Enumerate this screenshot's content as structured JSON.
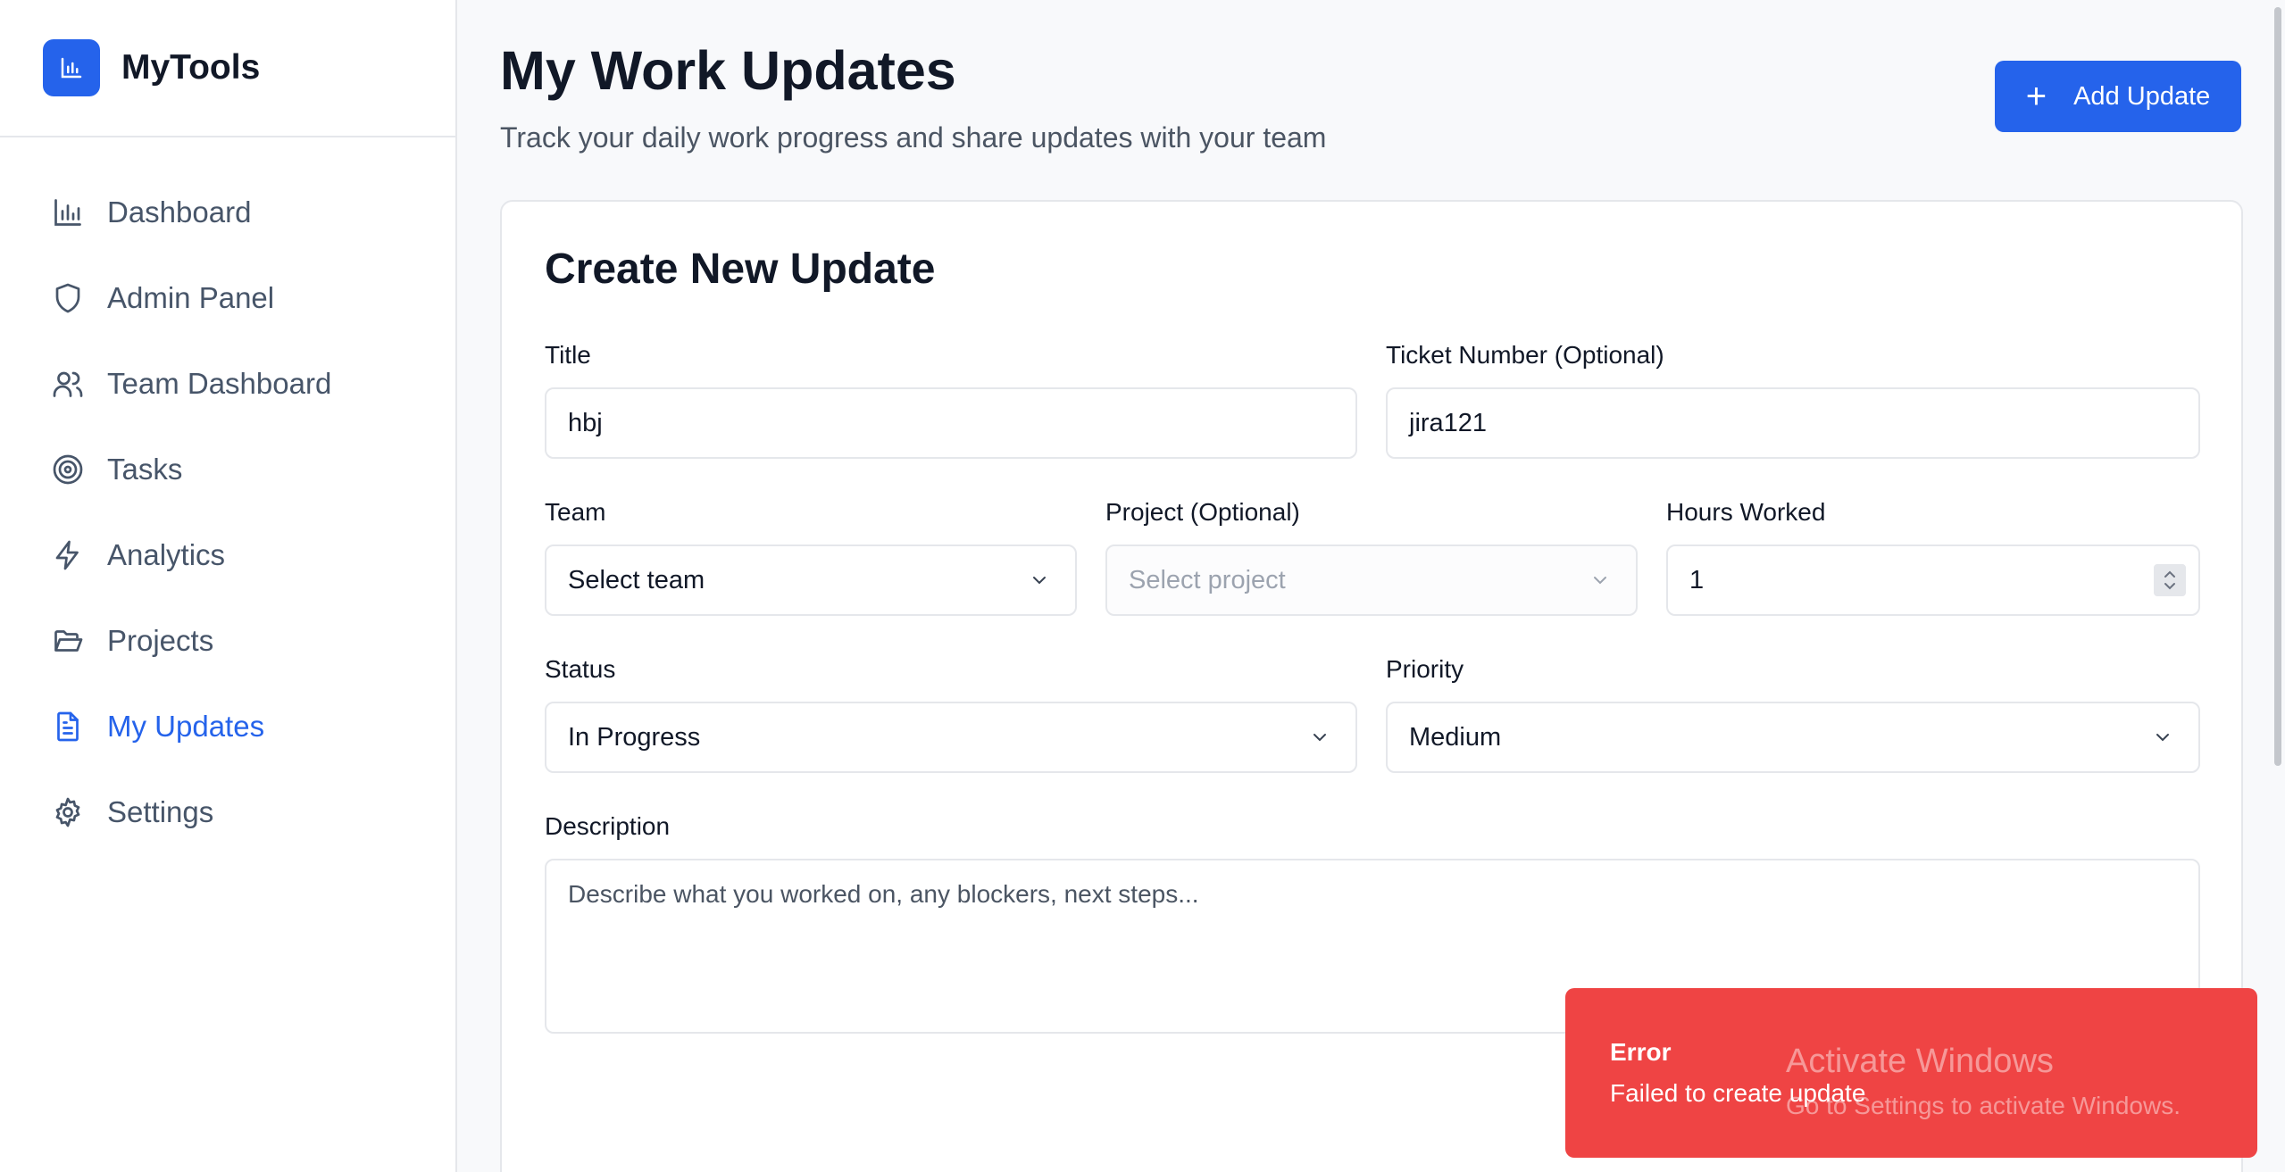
{
  "app": {
    "name": "MyTools"
  },
  "sidebar": {
    "items": [
      {
        "label": "Dashboard",
        "icon": "bar-chart-icon"
      },
      {
        "label": "Admin Panel",
        "icon": "shield-icon"
      },
      {
        "label": "Team Dashboard",
        "icon": "users-icon"
      },
      {
        "label": "Tasks",
        "icon": "target-icon"
      },
      {
        "label": "Analytics",
        "icon": "lightning-icon"
      },
      {
        "label": "Projects",
        "icon": "folder-icon"
      },
      {
        "label": "My Updates",
        "icon": "file-text-icon",
        "active": true
      },
      {
        "label": "Settings",
        "icon": "gear-icon"
      }
    ]
  },
  "header": {
    "title": "My Work Updates",
    "subtitle": "Track your daily work progress and share updates with your team",
    "add_button_label": "Add Update"
  },
  "form": {
    "title": "Create New Update",
    "title_field": {
      "label": "Title",
      "value": "hbj"
    },
    "ticket_field": {
      "label": "Ticket Number (Optional)",
      "value": "jira121"
    },
    "team_field": {
      "label": "Team",
      "value": "Select team"
    },
    "project_field": {
      "label": "Project (Optional)",
      "value": "Select project"
    },
    "hours_field": {
      "label": "Hours Worked",
      "value": "1"
    },
    "status_field": {
      "label": "Status",
      "value": "In Progress"
    },
    "priority_field": {
      "label": "Priority",
      "value": "Medium"
    },
    "description_field": {
      "label": "Description",
      "placeholder": "Describe what you worked on, any blockers, next steps..."
    }
  },
  "toast": {
    "title": "Error",
    "message": "Failed to create update"
  },
  "watermark": {
    "title": "Activate Windows",
    "subtitle": "Go to Settings to activate Windows."
  },
  "colors": {
    "accent": "#2563eb",
    "error": "#ef4444"
  }
}
